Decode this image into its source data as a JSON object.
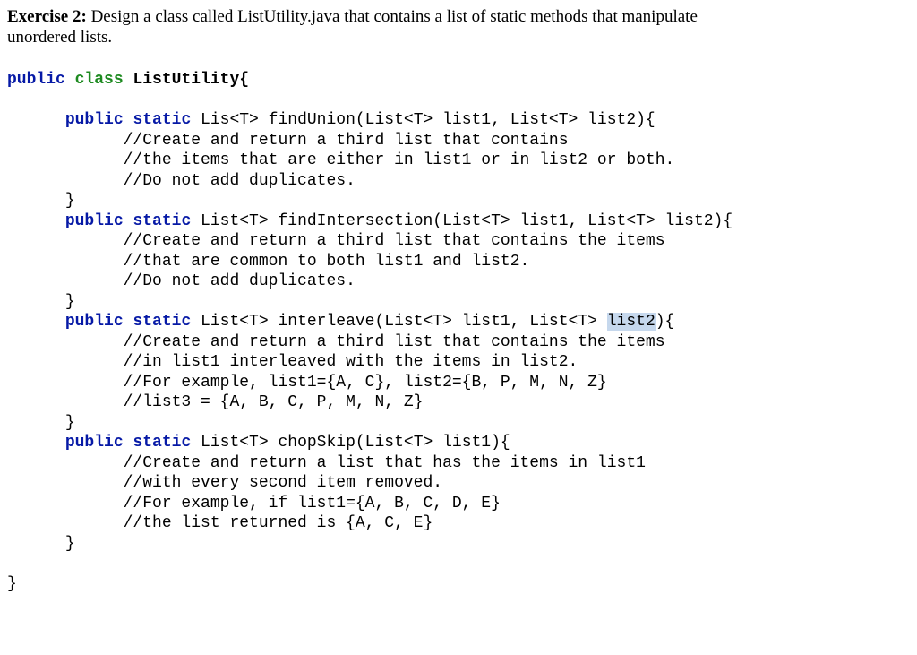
{
  "prompt": {
    "label": "Exercise 2:",
    "text1": " Design a class called ListUtility.java that contains a list of static methods that manipulate",
    "text2": "unordered lists."
  },
  "code": {
    "l0_public": "public",
    "l0_class": "class",
    "l0_name": " ListUtility{",
    "m1_public": "public",
    "m1_static": "static",
    "m1_sig": " Lis<T> findUnion(List<T> list1, List<T> list2){",
    "m1_c1": "//Create and return a third list that contains",
    "m1_c2": "//the items that are either in list1 or in list2 or both.",
    "m1_c3": "//Do not add duplicates.",
    "brace_close": "}",
    "m2_public": "public",
    "m2_static": "static",
    "m2_sig": " List<T> findIntersection(List<T> list1, List<T> list2){",
    "m2_c1": "//Create and return a third list that contains the items",
    "m2_c2": "//that are common to both list1 and list2.",
    "m2_c3": "//Do not add duplicates.",
    "m3_public": "public",
    "m3_static": "static",
    "m3_sig_a": " List<T> interleave(List<T> list1, List<T> ",
    "m3_hl": "list2",
    "m3_sig_b": "){",
    "m3_c1": "//Create and return a third list that contains the items",
    "m3_c2": "//in list1 interleaved with the items in list2.",
    "m3_c3": "//For example, list1={A, C}, list2={B, P, M, N, Z}",
    "m3_c4": "//list3 = {A, B, C, P, M, N, Z}",
    "m4_public": "public",
    "m4_static": "static",
    "m4_sig": " List<T> chopSkip(List<T> list1){",
    "m4_c1": "//Create and return a list that has the items in list1",
    "m4_c2": "//with every second item removed.",
    "m4_c3": "//For example, if list1={A, B, C, D, E}",
    "m4_c4": "//the list returned is {A, C, E}"
  }
}
